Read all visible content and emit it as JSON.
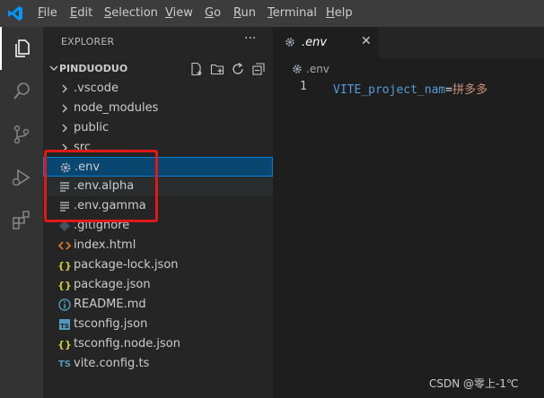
{
  "menu": [
    "File",
    "Edit",
    "Selection",
    "View",
    "Go",
    "Run",
    "Terminal",
    "Help"
  ],
  "explorer": {
    "title": "EXPLORER",
    "more": "···",
    "project": "PINDUODUO",
    "items": [
      {
        "label": ".vscode",
        "type": "folder"
      },
      {
        "label": "node_modules",
        "type": "folder"
      },
      {
        "label": "public",
        "type": "folder"
      },
      {
        "label": "src",
        "type": "folder"
      },
      {
        "label": ".env",
        "type": "gear",
        "selected": true
      },
      {
        "label": ".env.alpha",
        "type": "lines"
      },
      {
        "label": ".env.gamma",
        "type": "lines"
      },
      {
        "label": ".gitignore",
        "type": "git"
      },
      {
        "label": "index.html",
        "type": "html"
      },
      {
        "label": "package-lock.json",
        "type": "json"
      },
      {
        "label": "package.json",
        "type": "json"
      },
      {
        "label": "README.md",
        "type": "info"
      },
      {
        "label": "tsconfig.json",
        "type": "ts"
      },
      {
        "label": "tsconfig.node.json",
        "type": "json"
      },
      {
        "label": "vite.config.ts",
        "type": "ts-text"
      }
    ]
  },
  "editor": {
    "tab_label": ".env",
    "close": "✕",
    "breadcrumb": ".env",
    "line_number": "1",
    "code_key": "VITE_project_nam",
    "code_eq": "=",
    "code_value": "拼多多"
  },
  "watermark": "CSDN @零上-1℃",
  "colors": {
    "accent": "#007acc",
    "selection": "#094771",
    "highlight": "#e01818"
  }
}
